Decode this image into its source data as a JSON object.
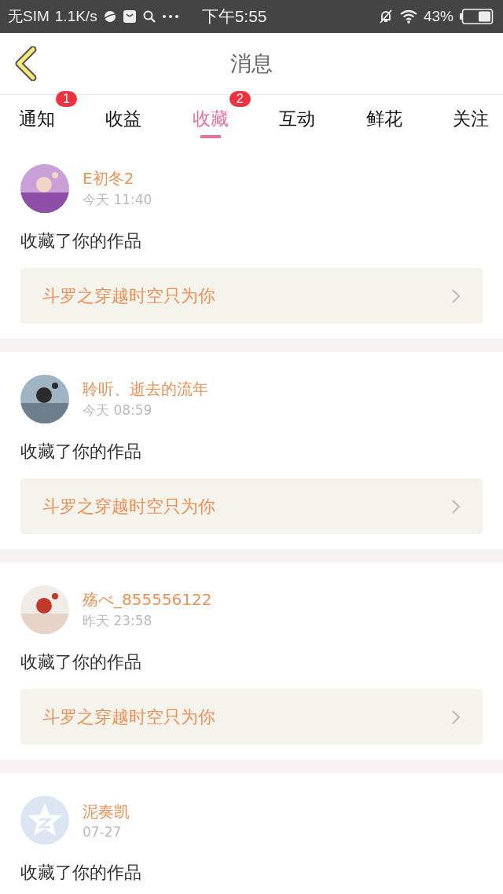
{
  "status_bar": {
    "carrier": "无SIM",
    "speed": "1.1K/s",
    "time": "下午5:55",
    "battery": "43%"
  },
  "header": {
    "title": "消息"
  },
  "tabs": [
    {
      "label": "通知",
      "selected": false,
      "badge": "1"
    },
    {
      "label": "收益",
      "selected": false
    },
    {
      "label": "收藏",
      "selected": true,
      "badge": "2"
    },
    {
      "label": "互动",
      "selected": false
    },
    {
      "label": "鲜花",
      "selected": false
    },
    {
      "label": "关注",
      "selected": false
    }
  ],
  "messages": [
    {
      "name": "E初冬2",
      "time": "今天 11:40",
      "action": "收藏了你的作品",
      "work": "斗罗之穿越时空只为你"
    },
    {
      "name": "聆听、逝去的流年",
      "time": "今天 08:59",
      "action": "收藏了你的作品",
      "work": "斗罗之穿越时空只为你"
    },
    {
      "name": "殇べ_855556122",
      "time": "昨天 23:58",
      "action": "收藏了你的作品",
      "work": "斗罗之穿越时空只为你"
    },
    {
      "avatar": {
        "kind": "default"
      },
      "name": "泥奏凯",
      "time": "07-27",
      "action": "收藏了你的作品"
    }
  ]
}
